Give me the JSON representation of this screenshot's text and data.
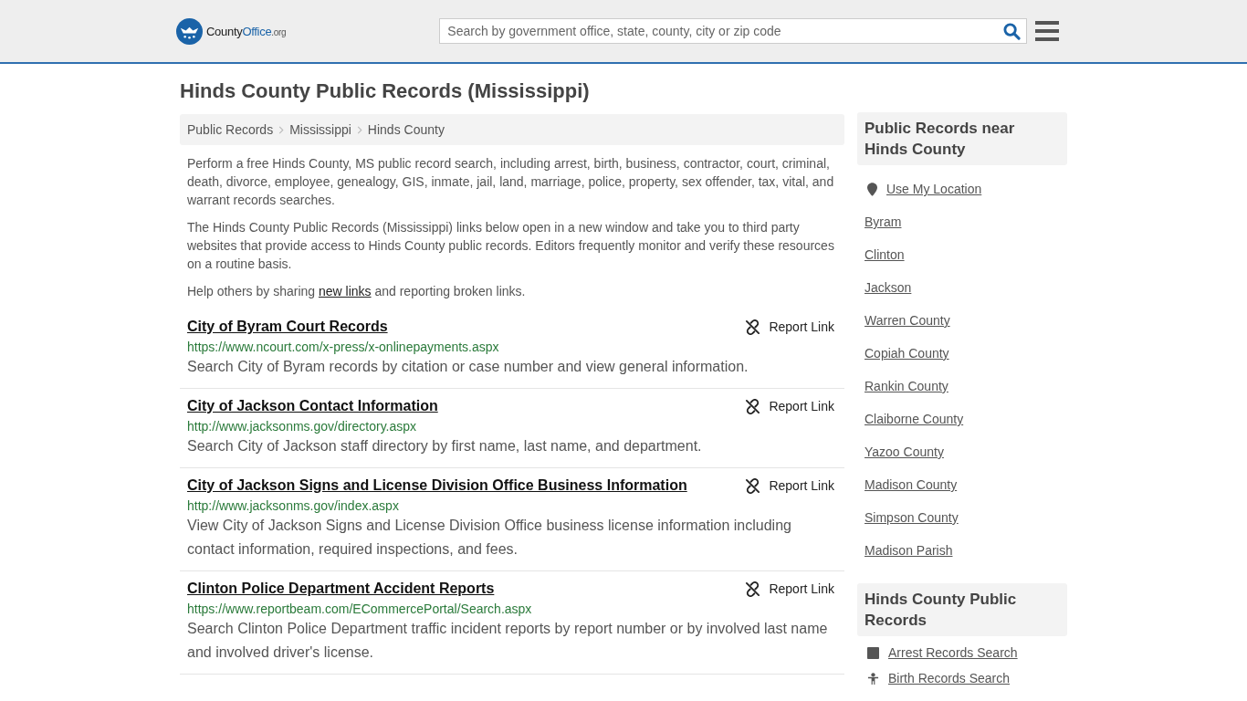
{
  "header": {
    "logo": {
      "name": "County",
      "highlight": "Office",
      "suffix": ".org"
    },
    "search": {
      "placeholder": "Search by government office, state, county, city or zip code"
    }
  },
  "title": "Hinds County Public Records (Mississippi)",
  "breadcrumbs": [
    "Public Records",
    "Mississippi",
    "Hinds County"
  ],
  "intro": [
    "Perform a free Hinds County, MS public record search, including arrest, birth, business, contractor, court, criminal, death, divorce, employee, genealogy, GIS, inmate, jail, land, marriage, police, property, sex offender, tax, vital, and warrant records searches.",
    "The Hinds County Public Records (Mississippi) links below open in a new window and take you to third party websites that provide access to Hinds County public records. Editors frequently monitor and verify these resources on a routine basis."
  ],
  "help": {
    "before": "Help others by sharing ",
    "link": "new links",
    "after": " and reporting broken links."
  },
  "records": [
    {
      "title": "City of Byram Court Records",
      "url": "https://www.ncourt.com/x-press/x-onlinepayments.aspx",
      "description": "Search City of Byram records by citation or case number and view general information.",
      "report": "Report Link"
    },
    {
      "title": "City of Jackson Contact Information",
      "url": "http://www.jacksonms.gov/directory.aspx",
      "description": "Search City of Jackson staff directory by first name, last name, and department.",
      "report": "Report Link"
    },
    {
      "title": "City of Jackson Signs and License Division Office Business Information",
      "url": "http://www.jacksonms.gov/index.aspx",
      "description": "View City of Jackson Signs and License Division Office business license information including contact information, required inspections, and fees.",
      "report": "Report Link"
    },
    {
      "title": "Clinton Police Department Accident Reports",
      "url": "https://www.reportbeam.com/ECommercePortal/Search.aspx",
      "description": "Search Clinton Police Department traffic incident reports by report number or by involved last name and involved driver's license.",
      "report": "Report Link"
    }
  ],
  "sidebar": [
    {
      "heading": "Public Records near Hinds County",
      "items": [
        {
          "label": "Use My Location",
          "kind": "location"
        },
        {
          "label": "Byram",
          "kind": "plain"
        },
        {
          "label": "Clinton",
          "kind": "plain"
        },
        {
          "label": "Jackson",
          "kind": "plain"
        },
        {
          "label": "Warren County",
          "kind": "plain"
        },
        {
          "label": "Copiah County",
          "kind": "plain"
        },
        {
          "label": "Rankin County",
          "kind": "plain"
        },
        {
          "label": "Claiborne County",
          "kind": "plain"
        },
        {
          "label": "Yazoo County",
          "kind": "plain"
        },
        {
          "label": "Madison County",
          "kind": "plain"
        },
        {
          "label": "Simpson County",
          "kind": "plain"
        },
        {
          "label": "Madison Parish",
          "kind": "plain"
        }
      ]
    },
    {
      "heading": "Hinds County Public Records",
      "items": [
        {
          "label": "Arrest Records Search",
          "kind": "square"
        },
        {
          "label": "Birth Records Search",
          "kind": "person"
        }
      ]
    }
  ]
}
